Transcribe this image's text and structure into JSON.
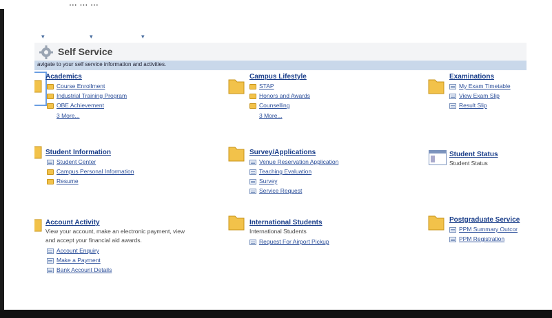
{
  "top_caption": "... ... ...",
  "header": {
    "title": "Self Service",
    "subtitle": "avigate to your self service information and activities."
  },
  "sections": {
    "academics": {
      "title": "Academics",
      "items": [
        "Course Enrollment",
        "Industrial Training Program",
        "OBE Achievement"
      ],
      "more": "3 More..."
    },
    "campus_lifestyle": {
      "title": "Campus Lifestyle",
      "items": [
        "STAP",
        "Honors and Awards",
        "Counselling"
      ],
      "more": "3 More..."
    },
    "examinations": {
      "title": "Examinations",
      "items": [
        "My Exam Timetable",
        "View Exam Slip",
        "Result Slip"
      ]
    },
    "student_information": {
      "title": "Student Information",
      "items": [
        "Student Center",
        "Campus Personal Information",
        "Resume"
      ]
    },
    "survey_applications": {
      "title": "Survey/Applications",
      "items": [
        "Venue Reservation Application",
        "Teaching Evaluation",
        "Survey",
        "Service Request"
      ]
    },
    "student_status": {
      "title": "Student Status",
      "description": "Student Status"
    },
    "account_activity": {
      "title": "Account Activity",
      "description_line1": "View your account, make an electronic payment, view",
      "description_line2": "and accept your financial aid awards.",
      "items": [
        "Account Enquiry",
        "Make a Payment",
        "Bank Account Details"
      ]
    },
    "international_students": {
      "title": "International Students",
      "description": "International Students",
      "items": [
        "Request For Airport Pickup"
      ]
    },
    "postgraduate_services": {
      "title": "Postgraduate Service",
      "items": [
        "PPM Summary Outcor",
        "PPM Registration"
      ]
    }
  },
  "colors": {
    "link": "#2c4f9a",
    "title": "#1a3e8a",
    "nav_strip": "#c9d8ea",
    "folder": "#f2c24a"
  }
}
